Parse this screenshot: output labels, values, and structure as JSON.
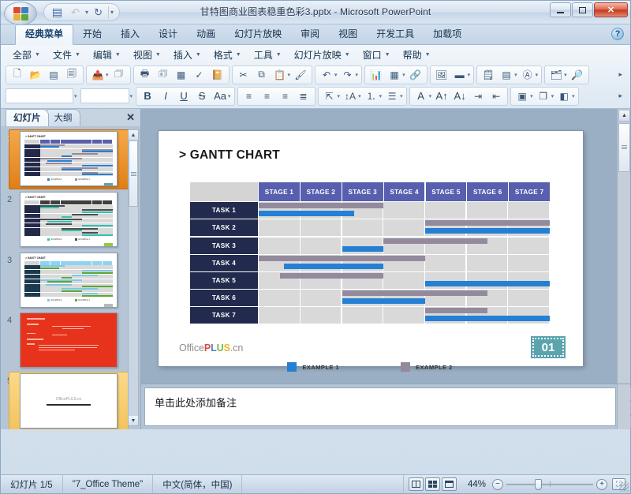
{
  "window": {
    "title": "甘特图商业图表稳重色彩3.pptx  -  Microsoft PowerPoint",
    "minimize_label": "",
    "maximize_label": "",
    "close_label": "✕"
  },
  "quick_access": {
    "office_orb": "office-orb",
    "buttons": [
      {
        "name": "save",
        "glyph": "💾"
      },
      {
        "name": "undo",
        "glyph": "↶"
      },
      {
        "name": "redo",
        "glyph": "↻"
      },
      {
        "name": "customize",
        "glyph": "▾"
      }
    ]
  },
  "ribbon_tabs": [
    {
      "label": "经典菜单",
      "active": true
    },
    {
      "label": "开始",
      "active": false
    },
    {
      "label": "插入",
      "active": false
    },
    {
      "label": "设计",
      "active": false
    },
    {
      "label": "动画",
      "active": false
    },
    {
      "label": "幻灯片放映",
      "active": false
    },
    {
      "label": "审阅",
      "active": false
    },
    {
      "label": "视图",
      "active": false
    },
    {
      "label": "开发工具",
      "active": false
    },
    {
      "label": "加载项",
      "active": false
    }
  ],
  "help_button": "?",
  "classic_menu": [
    "全部",
    "文件",
    "编辑",
    "视图",
    "插入",
    "格式",
    "工具",
    "幻灯片放映",
    "窗口",
    "帮助"
  ],
  "toolbar_row1": [
    {
      "name": "new-file-icon",
      "glyph": "🗋"
    },
    {
      "name": "open-folder-icon",
      "glyph": "📂"
    },
    {
      "name": "save-icon",
      "glyph": "💾"
    },
    {
      "name": "save-as-icon",
      "glyph": "📑"
    },
    {
      "name": "export-pdf-icon",
      "glyph": "📥"
    },
    {
      "name": "attach-icon",
      "glyph": "📎"
    },
    {
      "name": "print-icon",
      "glyph": "🖨"
    },
    {
      "name": "print-preview-icon",
      "glyph": "🔍"
    },
    {
      "name": "table-icon",
      "glyph": "▦"
    },
    {
      "name": "spellcheck-icon",
      "glyph": "✓"
    },
    {
      "name": "research-icon",
      "glyph": "📕"
    },
    {
      "name": "cut-icon",
      "glyph": "✂"
    },
    {
      "name": "copy-icon",
      "glyph": "⧉"
    },
    {
      "name": "paste-icon",
      "glyph": "📋"
    },
    {
      "name": "format-painter-icon",
      "glyph": "🖌"
    },
    {
      "name": "undo-icon",
      "glyph": "↶"
    },
    {
      "name": "redo-icon",
      "glyph": "↷"
    },
    {
      "name": "insert-chart-icon",
      "glyph": "📊"
    },
    {
      "name": "insert-table-icon",
      "glyph": "▦"
    },
    {
      "name": "hyperlink-icon",
      "glyph": "🔗"
    },
    {
      "name": "insert-picture-icon",
      "glyph": "🖼"
    },
    {
      "name": "slide-design-icon",
      "glyph": "▬"
    },
    {
      "name": "new-slide-icon",
      "glyph": "🗒"
    },
    {
      "name": "slide-layout-icon",
      "glyph": "▤"
    },
    {
      "name": "text-box-icon",
      "glyph": "A"
    },
    {
      "name": "insert-object-icon",
      "glyph": "🗂"
    },
    {
      "name": "zoom-icon",
      "glyph": "🔎"
    }
  ],
  "toolbar_row2": {
    "font_combo": "",
    "size_combo": "",
    "bold": "B",
    "italic": "I",
    "underline": "U",
    "shadow": "S",
    "change_case": "Aa",
    "align_left": "≡",
    "align_center": "≡",
    "align_right": "≡",
    "justify": "≣",
    "line_spacing": "↕",
    "columns": "▥",
    "numbered_list": "⒈",
    "bulleted_list": "☰",
    "font_color": "A",
    "grow_font": "A",
    "shrink_font": "A",
    "increase_indent": "→",
    "decrease_indent": "←",
    "arrange": "▣",
    "group": "❐",
    "shape-fill": "◧"
  },
  "left_pane": {
    "tabs": [
      {
        "label": "幻灯片",
        "active": true
      },
      {
        "label": "大纲",
        "active": false
      }
    ],
    "close_label": "✕",
    "thumbnails": [
      {
        "number": "1",
        "selected": true,
        "theme": "blue",
        "title": "> GANTT CHART"
      },
      {
        "number": "2",
        "selected": false,
        "theme": "teal",
        "title": "> GANTT CHART"
      },
      {
        "number": "3",
        "selected": false,
        "theme": "green",
        "title": "> GANTT CHART"
      },
      {
        "number": "4",
        "selected": false,
        "theme": "red",
        "title": ""
      },
      {
        "number": "5",
        "selected": false,
        "theme": "white",
        "title": "OfficePLUS.cn"
      }
    ]
  },
  "slide": {
    "title_prefix": ">",
    "title": "GANTT CHART",
    "footer_logo": {
      "office": "Office",
      "p": "P",
      "l": "L",
      "u": "U",
      "s": "S",
      "cn": ".cn"
    },
    "page_number": "01"
  },
  "chart_data": {
    "type": "bar",
    "title": "GANTT CHART",
    "categories": [
      "STAGE 1",
      "STAGE 2",
      "STAGE 3",
      "STAGE 4",
      "STAGE 5",
      "STAGE 6",
      "STAGE 7"
    ],
    "rows": [
      "TASK 1",
      "TASK 2",
      "TASK 3",
      "TASK 4",
      "TASK 5",
      "TASK 6",
      "TASK 7"
    ],
    "legend": [
      {
        "name": "EXAMPLE 1",
        "color": "#2580d4"
      },
      {
        "name": "EXAMPLE 2",
        "color": "#948a9d"
      }
    ],
    "legend_position": "bottom-center",
    "xlabel": "",
    "ylabel": "",
    "grid": true,
    "series": [
      {
        "name": "EXAMPLE 2",
        "color": "#948a9d",
        "bars": [
          {
            "row": "TASK 1",
            "start": 0.0,
            "end": 3.0
          },
          {
            "row": "TASK 2",
            "start": 4.0,
            "end": 7.0
          },
          {
            "row": "TASK 3",
            "start": 3.0,
            "end": 5.5
          },
          {
            "row": "TASK 4",
            "start": 0.0,
            "end": 4.0
          },
          {
            "row": "TASK 5",
            "start": 0.5,
            "end": 3.0
          },
          {
            "row": "TASK 6",
            "start": 2.0,
            "end": 5.5
          },
          {
            "row": "TASK 7",
            "start": 4.0,
            "end": 5.5
          }
        ]
      },
      {
        "name": "EXAMPLE 1",
        "color": "#2580d4",
        "bars": [
          {
            "row": "TASK 1",
            "start": 0.0,
            "end": 2.3
          },
          {
            "row": "TASK 2",
            "start": 4.0,
            "end": 7.0
          },
          {
            "row": "TASK 3",
            "start": 2.0,
            "end": 3.0
          },
          {
            "row": "TASK 4",
            "start": 0.6,
            "end": 3.0
          },
          {
            "row": "TASK 5",
            "start": 4.0,
            "end": 7.0
          },
          {
            "row": "TASK 6",
            "start": 2.0,
            "end": 4.0
          },
          {
            "row": "TASK 7",
            "start": 4.0,
            "end": 7.0
          }
        ]
      }
    ]
  },
  "notes": {
    "placeholder": "单击此处添加备注"
  },
  "status_bar": {
    "slide_counter": "幻灯片 1/5",
    "theme": "\"7_Office Theme\"",
    "language": "中文(简体，中国)",
    "zoom_percent": "44%",
    "zoom_out": "−",
    "zoom_in": "+",
    "views": [
      {
        "name": "normal-view",
        "label": ""
      },
      {
        "name": "slide-sorter-view",
        "label": ""
      },
      {
        "name": "reading-view",
        "label": ""
      }
    ],
    "fit_to_window": "⛶"
  },
  "colors": {
    "header_purple": "#575fae",
    "task_navy": "#222a4d",
    "cell_gray": "#d9d9d9",
    "bar_blue": "#2580d4",
    "bar_mauve": "#948a9d",
    "badge_teal": "#5ba3ad",
    "selection_orange": "#e07f18"
  }
}
